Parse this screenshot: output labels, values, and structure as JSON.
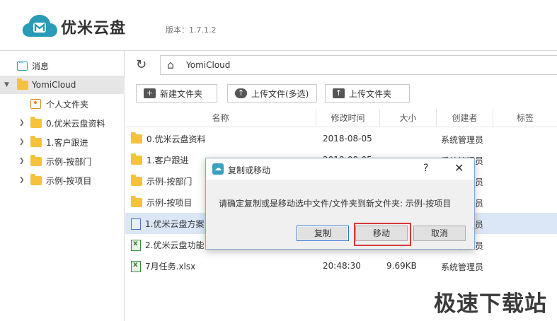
{
  "app": {
    "brand": "优米云盘",
    "version": "版本：1.7.1.2"
  },
  "sidebar": {
    "messages_label": "消息",
    "root_label": "YomiCloud",
    "items": [
      {
        "label": "个人文件夹"
      },
      {
        "label": "0.优米云盘资料"
      },
      {
        "label": "1.客户跟进"
      },
      {
        "label": "示例-按部门"
      },
      {
        "label": "示例-按项目"
      }
    ]
  },
  "path": {
    "current": "YomiCloud"
  },
  "toolbar": {
    "new_folder": "新建文件夹",
    "upload_multi": "上传文件(多选)",
    "upload_folder": "上传文件夹"
  },
  "table": {
    "headers": {
      "name": "名称",
      "modified": "修改时间",
      "size": "大小",
      "creator": "创建者",
      "tag": "标签"
    },
    "rows": [
      {
        "name": "0.优米云盘资料",
        "modified": "2018-08-05",
        "size": "",
        "creator": "系统管理员"
      },
      {
        "name": "1.客户跟进",
        "modified": "2018-08-05",
        "size": "",
        "creator": "系统管理员"
      },
      {
        "name": "示例-按部门",
        "modified": "",
        "size": "",
        "creator": "系统管理员"
      },
      {
        "name": "示例-按项目",
        "modified": "",
        "size": "",
        "creator": "系统管理员"
      },
      {
        "name": "1.优米云盘方案",
        "modified": "",
        "size": "",
        "creator": "系统管理员"
      },
      {
        "name": "2.优米云盘功能",
        "modified": "",
        "size": "",
        "creator": "系统管理员"
      },
      {
        "name": "7月任务.xlsx",
        "modified": "20:48:30",
        "size": "9.69KB",
        "creator": "系统管理员"
      }
    ]
  },
  "dialog": {
    "title": "复制或移动",
    "help": "?",
    "close": "✕",
    "message": "请确定复制或是移动选中文件/文件夹到新文件夹: 示例-按项目",
    "copy_label": "复制",
    "move_label": "移动",
    "cancel_label": "取消"
  },
  "watermark": "极速下载站",
  "colors": {
    "brand": "#2a9bb6",
    "folder": "#f5c23a",
    "selected_row": "#dbe7f7",
    "highlight": "#d63a3a"
  }
}
